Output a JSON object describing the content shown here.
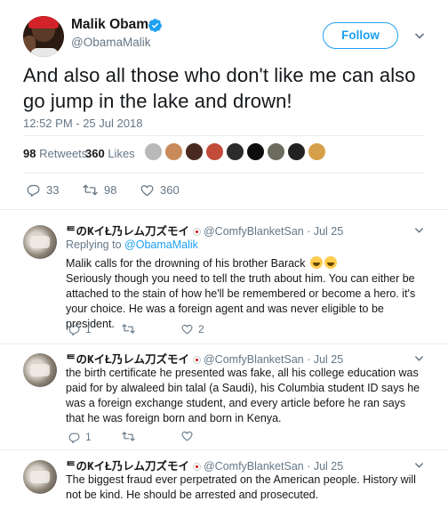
{
  "main_tweet": {
    "author_name": "Malik Obama",
    "author_handle": "@ObamaMalik",
    "follow_label": "Follow",
    "text": "And also all those who don't like me can also go jump in the lake and drown!",
    "timestamp": "12:52 PM - 25 Jul 2018",
    "retweets_count": "98",
    "retweets_label": "Retweets",
    "likes_count": "360",
    "likes_label": "Likes",
    "actions": {
      "replies": "33",
      "retweets": "98",
      "likes": "360"
    }
  },
  "replies": [
    {
      "display_name": "ᄐのҜイŁ乃レム刀ズモイ",
      "handle": "@ComfyBlanketSan",
      "date": "Jul 25",
      "replying_prefix": "Replying to",
      "replying_to": "@ObamaMalik",
      "text_line1": "Malik calls for the drowning of his brother Barack",
      "text_rest": "Seriously though you need to tell the truth about him. You can either be attached to the stain of how he'll be remembered or become a hero. it's your choice. He was a foreign agent and was never eligible to be president.",
      "reply_count": "1",
      "retweet_count": "",
      "like_count": "2"
    },
    {
      "display_name": "ᄐのҜイŁ乃レム刀ズモイ",
      "handle": "@ComfyBlanketSan",
      "date": "Jul 25",
      "text": "the birth certificate he presented was fake, all his college education was paid for by alwaleed bin talal (a Saudi), his Columbia student ID says he was a foreign exchange student, and every article before he ran says that he was foreign born and born in Kenya.",
      "reply_count": "1",
      "retweet_count": "",
      "like_count": ""
    },
    {
      "display_name": "ᄐのҜイŁ乃レム刀ズモイ",
      "handle": "@ComfyBlanketSan",
      "date": "Jul 25",
      "text": "The biggest fraud ever perpetrated on the American people. History will not be kind. He should be arrested and prosecuted."
    }
  ],
  "colors": {
    "accent": "#1da1f2",
    "muted": "#657786",
    "text": "#14171a",
    "divider": "#e6ecf0"
  }
}
